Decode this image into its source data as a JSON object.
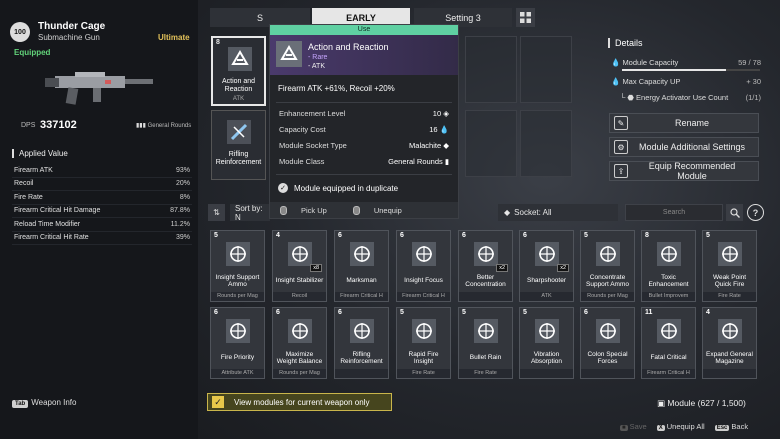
{
  "weapon": {
    "level": "100",
    "name": "Thunder Cage",
    "type": "Submachine Gun",
    "tier": "Ultimate",
    "status": "Equipped",
    "dps_label": "DPS",
    "dps_value": "337102",
    "ammo": "General Rounds"
  },
  "applied": {
    "title": "Applied Value",
    "rows": [
      {
        "name": "Firearm ATK",
        "value": "93%"
      },
      {
        "name": "Recoil",
        "value": "20%"
      },
      {
        "name": "Fire Rate",
        "value": "8%"
      },
      {
        "name": "Firearm Critical Hit Damage",
        "value": "87.8%"
      },
      {
        "name": "Reload Time Modifier",
        "value": "11.2%"
      },
      {
        "name": "Firearm Critical Hit Rate",
        "value": "39%"
      }
    ]
  },
  "tabs": {
    "s": "S",
    "early": "EARLY",
    "setting": "Setting 3"
  },
  "details": {
    "title": "Details",
    "capacity_label": "Module Capacity",
    "capacity_value": "59 / 78",
    "capacity_fraction": 0.756,
    "maxcap_label": "Max Capacity UP",
    "maxcap_value": "+ 30",
    "activator_label": "Energy Activator Use Count",
    "activator_value": "(1/1)"
  },
  "actions": {
    "rename": "Rename",
    "additional": "Module Additional Settings",
    "recommend": "Equip Recommended Module"
  },
  "slots": [
    {
      "cost": "8",
      "name": "Action and Reaction",
      "foot": "ATK",
      "icon": "action-reaction-icon"
    },
    {
      "cost": "",
      "name": "Rifling Reinforcement",
      "foot": "",
      "icon": "rifling-icon"
    }
  ],
  "tooltip": {
    "use_label": "Use",
    "title": "Action and Reaction",
    "rarity": "- Rare",
    "class_tag": "- ATK",
    "effect": "Firearm ATK +61%, Recoil +20%",
    "enh_label": "Enhancement Level",
    "enh_value": "10",
    "cost_label": "Capacity Cost",
    "cost_value": "16",
    "socket_label": "Module Socket Type",
    "socket_value": "Malachite",
    "class_label": "Module Class",
    "class_value": "General Rounds",
    "dup_text": "Module equipped in duplicate",
    "pickup": "Pick Up",
    "unequip": "Unequip"
  },
  "filters": {
    "sortby": "Sort by: N",
    "socket": "Socket: All",
    "search_placeholder": "Search"
  },
  "modules": [
    {
      "cost": "5",
      "name": "Insight Support Ammo",
      "foot": "Rounds per Mag",
      "count": ""
    },
    {
      "cost": "4",
      "name": "Insight Stabilizer",
      "foot": "Recoil",
      "count": "x8"
    },
    {
      "cost": "6",
      "name": "Marksman",
      "foot": "Firearm Critical H",
      "count": ""
    },
    {
      "cost": "6",
      "name": "Insight Focus",
      "foot": "Firearm Critical H",
      "count": ""
    },
    {
      "cost": "6",
      "name": "Better Concentration",
      "foot": "",
      "count": "x2"
    },
    {
      "cost": "6",
      "name": "Sharpshooter",
      "foot": "ATK",
      "count": "x2"
    },
    {
      "cost": "5",
      "name": "Concentrate Support Ammo",
      "foot": "Rounds per Mag",
      "count": ""
    },
    {
      "cost": "8",
      "name": "Toxic Enhancement",
      "foot": "Bullet Improvem",
      "count": ""
    },
    {
      "cost": "5",
      "name": "Weak Point Quick Fire",
      "foot": "Fire Rate",
      "count": ""
    },
    {
      "cost": "6",
      "name": "Fire Priority",
      "foot": "Attribute ATK",
      "count": ""
    },
    {
      "cost": "6",
      "name": "Maximize Weight Balance",
      "foot": "Rounds per Mag",
      "count": ""
    },
    {
      "cost": "6",
      "name": "Rifling Reinforcement",
      "foot": "",
      "count": ""
    },
    {
      "cost": "5",
      "name": "Rapid Fire Insight",
      "foot": "Fire Rate",
      "count": ""
    },
    {
      "cost": "5",
      "name": "Bullet Rain",
      "foot": "Fire Rate",
      "count": ""
    },
    {
      "cost": "5",
      "name": "Vibration Absorption",
      "foot": "",
      "count": ""
    },
    {
      "cost": "6",
      "name": "Colon Special Forces",
      "foot": "",
      "count": ""
    },
    {
      "cost": "11",
      "name": "Fatal Critical",
      "foot": "Firearm Critical H",
      "count": ""
    },
    {
      "cost": "4",
      "name": "Expand General Magazine",
      "foot": "",
      "count": ""
    }
  ],
  "bottom": {
    "weapon_info": "Weapon Info",
    "weapon_info_key": "Tab",
    "current_weapon": "View modules for current weapon only",
    "module_label": "Module (627 / 1,500)",
    "save": "Save",
    "unequip_all": "Unequip All",
    "back": "Back",
    "key_x": "X",
    "key_esc": "Esc"
  },
  "colors": {
    "accent": "#e8c84a",
    "use_green": "#5fd0a2",
    "rare": "#c7a6ff",
    "equipped": "#62d37a"
  }
}
